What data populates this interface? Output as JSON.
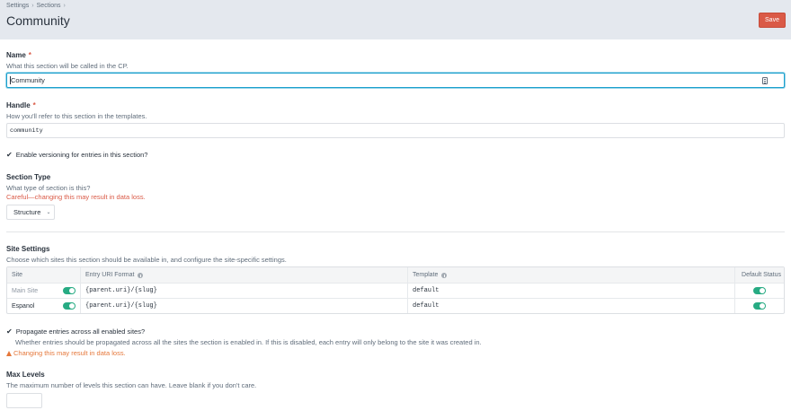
{
  "header": {
    "breadcrumbs": [
      "Settings",
      "Sections"
    ],
    "breadcrumb_separator": "›",
    "title": "Community",
    "save_label": "Save"
  },
  "name_field": {
    "label": "Name",
    "required_mark": "*",
    "instructions": "What this section will be called in the CP.",
    "value": "Community"
  },
  "handle_field": {
    "label": "Handle",
    "required_mark": "*",
    "instructions": "How you'll refer to this section in the templates.",
    "value": "community"
  },
  "versioning": {
    "checked": true,
    "label": "Enable versioning for entries in this section?"
  },
  "section_type": {
    "label": "Section Type",
    "instructions": "What type of section is this?",
    "warning": "Careful—changing this may result in data loss.",
    "selected": "Structure"
  },
  "site_settings": {
    "label": "Site Settings",
    "instructions": "Choose which sites this section should be available in, and configure the site-specific settings.",
    "columns": [
      "Site",
      "Entry URI Format",
      "Template",
      "Default Status"
    ],
    "rows": [
      {
        "site": "Main Site",
        "enabled": true,
        "uri_format": "{parent.uri}/{slug}",
        "template": "default",
        "default_status": true
      },
      {
        "site": "Espanol",
        "enabled": true,
        "uri_format": "{parent.uri}/{slug}",
        "template": "default",
        "default_status": true
      }
    ]
  },
  "propagate": {
    "checked": true,
    "label": "Propagate entries across all enabled sites?",
    "instructions": "Whether entries should be propagated across all the sites the section is enabled in. If this is disabled, each entry will only belong to the site it was created in.",
    "warning": "Changing this may result in data loss."
  },
  "max_levels": {
    "label": "Max Levels",
    "instructions": "The maximum number of levels this section can have. Leave blank if you don't care.",
    "value": ""
  },
  "colors": {
    "accent_focus": "#1ba0cd",
    "danger": "#da5a47",
    "warning": "#e5773a",
    "toggle_on": "#27ab83",
    "header_bg": "#e4e8ee"
  }
}
